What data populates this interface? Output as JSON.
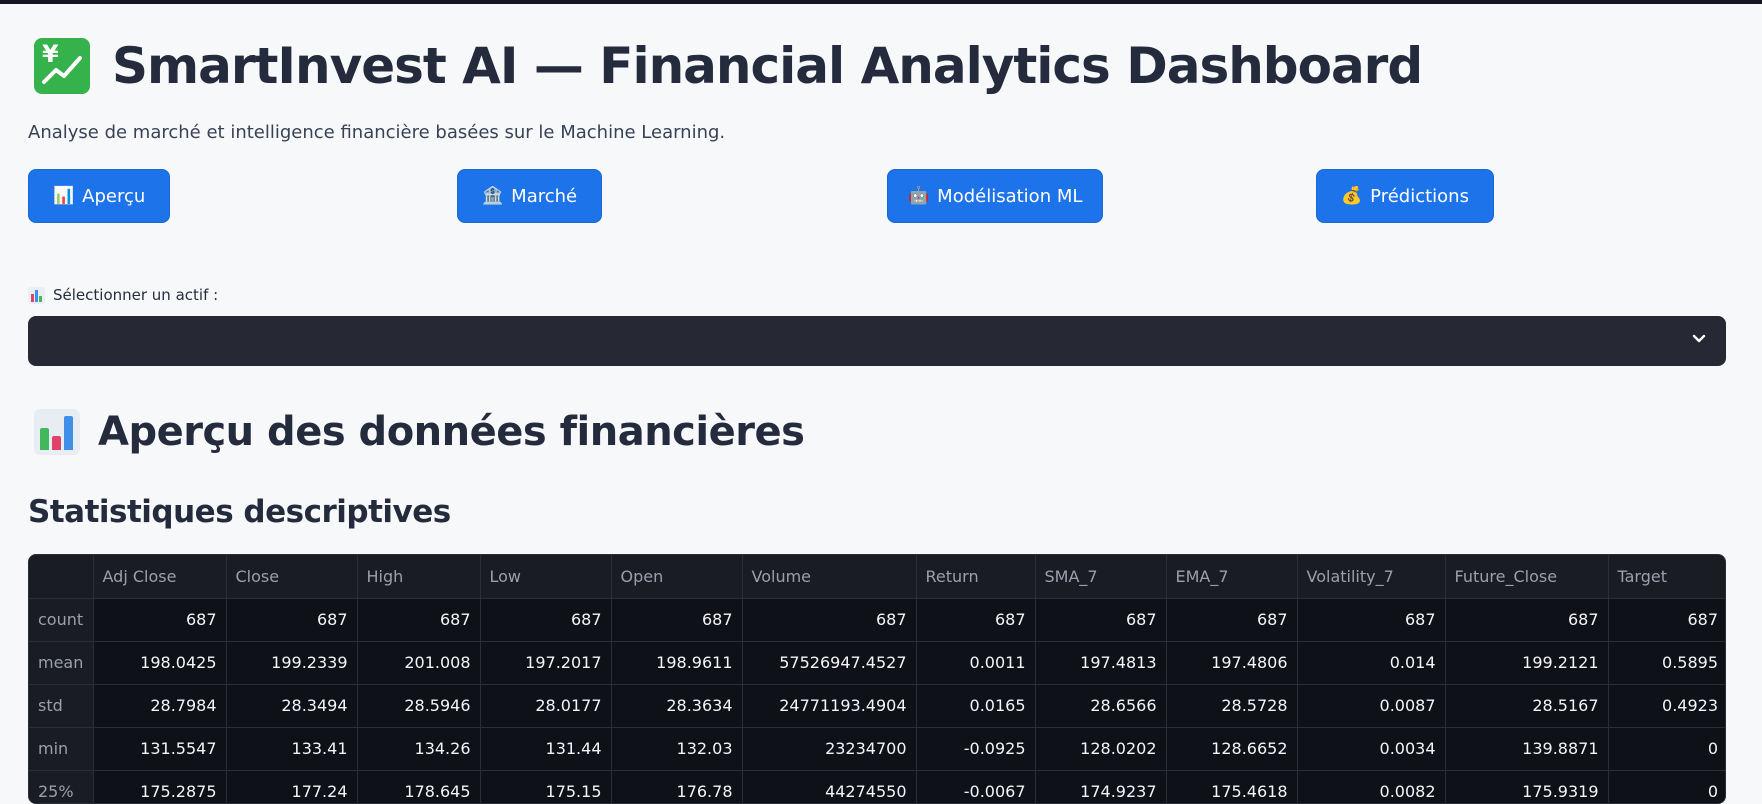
{
  "header": {
    "title": "SmartInvest AI — Financial Analytics Dashboard",
    "subtitle": "Analyse de marché et intelligence financière basées sur le Machine Learning.",
    "icon": "chart-increasing-yen-icon"
  },
  "nav": {
    "buttons": [
      {
        "icon": "📊",
        "label": "Aperçu"
      },
      {
        "icon": "🏦",
        "label": "Marché"
      },
      {
        "icon": "🤖",
        "label": "Modélisation ML"
      },
      {
        "icon": "💰",
        "label": "Prédictions"
      }
    ]
  },
  "selector": {
    "label": "Sélectionner un actif :",
    "value": ""
  },
  "section": {
    "title": "Aperçu des données financières",
    "subtitle": "Statistiques descriptives"
  },
  "table": {
    "columns": [
      "",
      "Adj Close",
      "Close",
      "High",
      "Low",
      "Open",
      "Volume",
      "Return",
      "SMA_7",
      "EMA_7",
      "Volatility_7",
      "Future_Close",
      "Target"
    ],
    "rows": [
      [
        "count",
        "687",
        "687",
        "687",
        "687",
        "687",
        "687",
        "687",
        "687",
        "687",
        "687",
        "687",
        "687"
      ],
      [
        "mean",
        "198.0425",
        "199.2339",
        "201.008",
        "197.2017",
        "198.9611",
        "57526947.4527",
        "0.0011",
        "197.4813",
        "197.4806",
        "0.014",
        "199.2121",
        "0.5895"
      ],
      [
        "std",
        "28.7984",
        "28.3494",
        "28.5946",
        "28.0177",
        "28.3634",
        "24771193.4904",
        "0.0165",
        "28.6566",
        "28.5728",
        "0.0087",
        "28.5167",
        "0.4923"
      ],
      [
        "min",
        "131.5547",
        "133.41",
        "134.26",
        "131.44",
        "132.03",
        "23234700",
        "-0.0925",
        "128.0202",
        "128.6652",
        "0.0034",
        "139.8871",
        "0"
      ],
      [
        "25%",
        "175.2875",
        "177.24",
        "178.645",
        "175.15",
        "176.78",
        "44274550",
        "-0.0067",
        "174.9237",
        "175.4618",
        "0.0082",
        "175.9319",
        "0"
      ]
    ]
  },
  "colors": {
    "accent": "#1c73ea",
    "table_bg": "#0e1117",
    "select_bg": "#262833",
    "icon_green": "#35b24b"
  }
}
